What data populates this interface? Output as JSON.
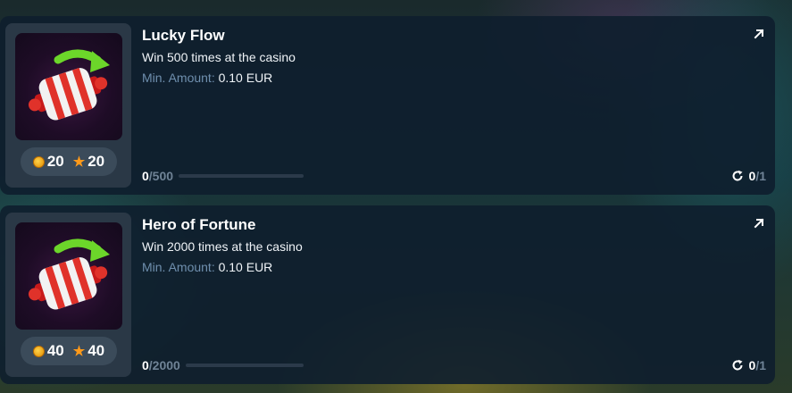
{
  "min_amount_label": "Min. Amount:",
  "quests": [
    {
      "title": "Lucky Flow",
      "description": "Win 500 times at the casino",
      "min_amount": "0.10 EUR",
      "coins": "20",
      "stars": "20",
      "progress_current": "0",
      "progress_total": "/500",
      "progress_fraction": 0,
      "attempts_current": "0",
      "attempts_total": "/1"
    },
    {
      "title": "Hero of Fortune",
      "description": "Win 2000 times at the casino",
      "min_amount": "0.10 EUR",
      "coins": "40",
      "stars": "40",
      "progress_current": "0",
      "progress_total": "/2000",
      "progress_fraction": 0,
      "attempts_current": "0",
      "attempts_total": "/1"
    }
  ],
  "colors": {
    "card_bg": "#0e1e2e",
    "label_blue": "#6f8fae",
    "coin": "#ffc21a",
    "star": "#ff9a1a"
  }
}
